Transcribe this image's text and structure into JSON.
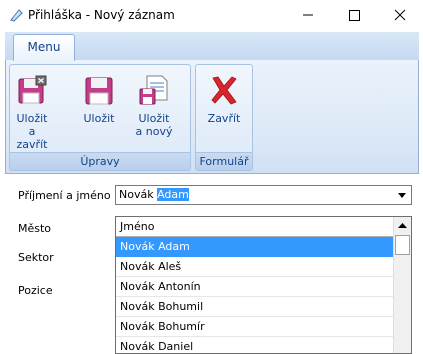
{
  "window": {
    "title": "Přihláška - Nový záznam",
    "minimize_glyph": "—",
    "maximize_glyph": "☐",
    "close_glyph": "✕"
  },
  "ribbon": {
    "tab_menu": "Menu",
    "groups": {
      "upravy": "Úpravy",
      "formular": "Formulář"
    },
    "buttons": {
      "save_close": [
        "Uložit",
        "a zavřít"
      ],
      "save": [
        "Uložit"
      ],
      "save_new": [
        "Uložit",
        "a nový"
      ],
      "close": [
        "Zavřít"
      ]
    }
  },
  "form": {
    "labels": {
      "name": "Příjmení a jméno",
      "city": "Město",
      "sector": "Sektor",
      "position": "Pozice"
    },
    "name_combo": {
      "value_plain": "Novák ",
      "value_selected": "Adam"
    },
    "dropdown": {
      "column_header": "Jméno",
      "items": [
        "Novák Adam",
        "Novák Aleš",
        "Novák Antonín",
        "Novák Bohumil",
        "Novák Bohumír",
        "Novák Daniel"
      ],
      "selected_index": 0
    }
  },
  "colors": {
    "accent": "#3399ff",
    "ribbon_text": "#15428b",
    "close_x": "#d8262c"
  }
}
